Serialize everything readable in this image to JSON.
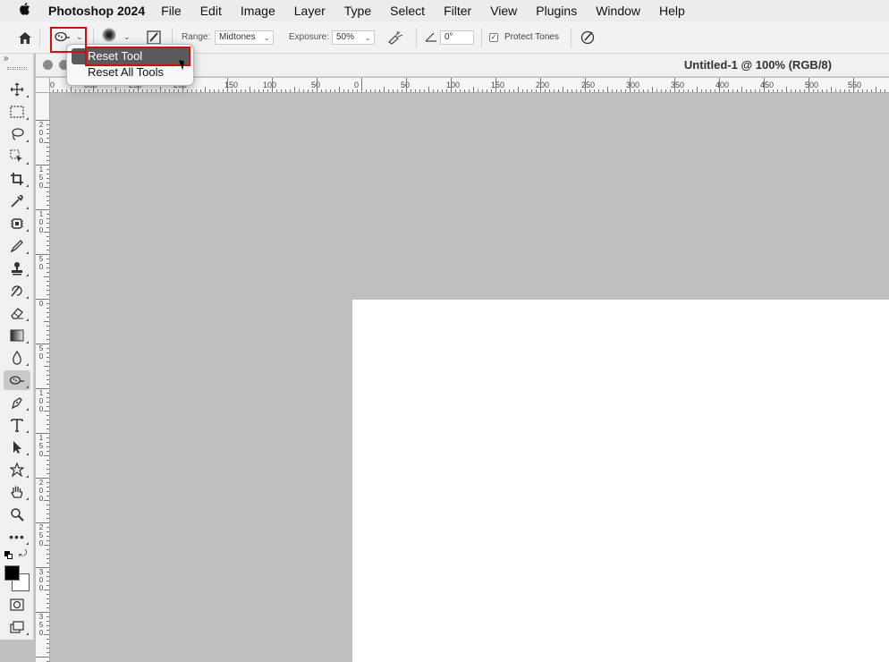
{
  "menubar": {
    "app_name": "Photoshop 2024",
    "items": [
      "File",
      "Edit",
      "Image",
      "Layer",
      "Type",
      "Select",
      "Filter",
      "View",
      "Plugins",
      "Window",
      "Help"
    ]
  },
  "options": {
    "range_label": "Range:",
    "range_value": "Midtones",
    "exposure_label": "Exposure:",
    "exposure_value": "50%",
    "angle_value": "0°",
    "protect_tones_label": "Protect Tones",
    "protect_tones_checked": true
  },
  "popup": {
    "items": [
      "Reset Tool",
      "Reset All Tools"
    ]
  },
  "document": {
    "title": "Untitled-1 @ 100% (RGB/8)"
  },
  "ruler_h_labels": [
    "0",
    "300",
    "250",
    "200",
    "150",
    "100",
    "50",
    "0",
    "50",
    "100",
    "150",
    "200",
    "250",
    "300",
    "350",
    "400",
    "450",
    "500",
    "550"
  ],
  "ruler_v_labels": [
    "2 0 0",
    "1 5 0",
    "1 0 0",
    "5 0",
    "0",
    "5 0",
    "1 0 0",
    "1 5 0",
    "2 0 0",
    "2 5 0",
    "3 0 0",
    "3 5 0"
  ],
  "tools": [
    "move-tool-icon",
    "marquee-tool-icon",
    "lasso-tool-icon",
    "object-select-tool-icon",
    "crop-tool-icon",
    "eyedropper-tool-icon",
    "healing-brush-tool-icon",
    "brush-tool-icon",
    "clone-stamp-tool-icon",
    "history-brush-tool-icon",
    "eraser-tool-icon",
    "gradient-tool-icon",
    "blur-tool-icon",
    "dodge-tool-icon",
    "pen-tool-icon",
    "type-tool-icon",
    "path-select-tool-icon",
    "shape-tool-icon",
    "hand-tool-icon",
    "zoom-tool-icon",
    "more-tools-icon"
  ],
  "colors": {
    "highlight": "#5a5a5a",
    "annotation_red": "#d01010",
    "pasteboard": "#bfbfbf"
  }
}
